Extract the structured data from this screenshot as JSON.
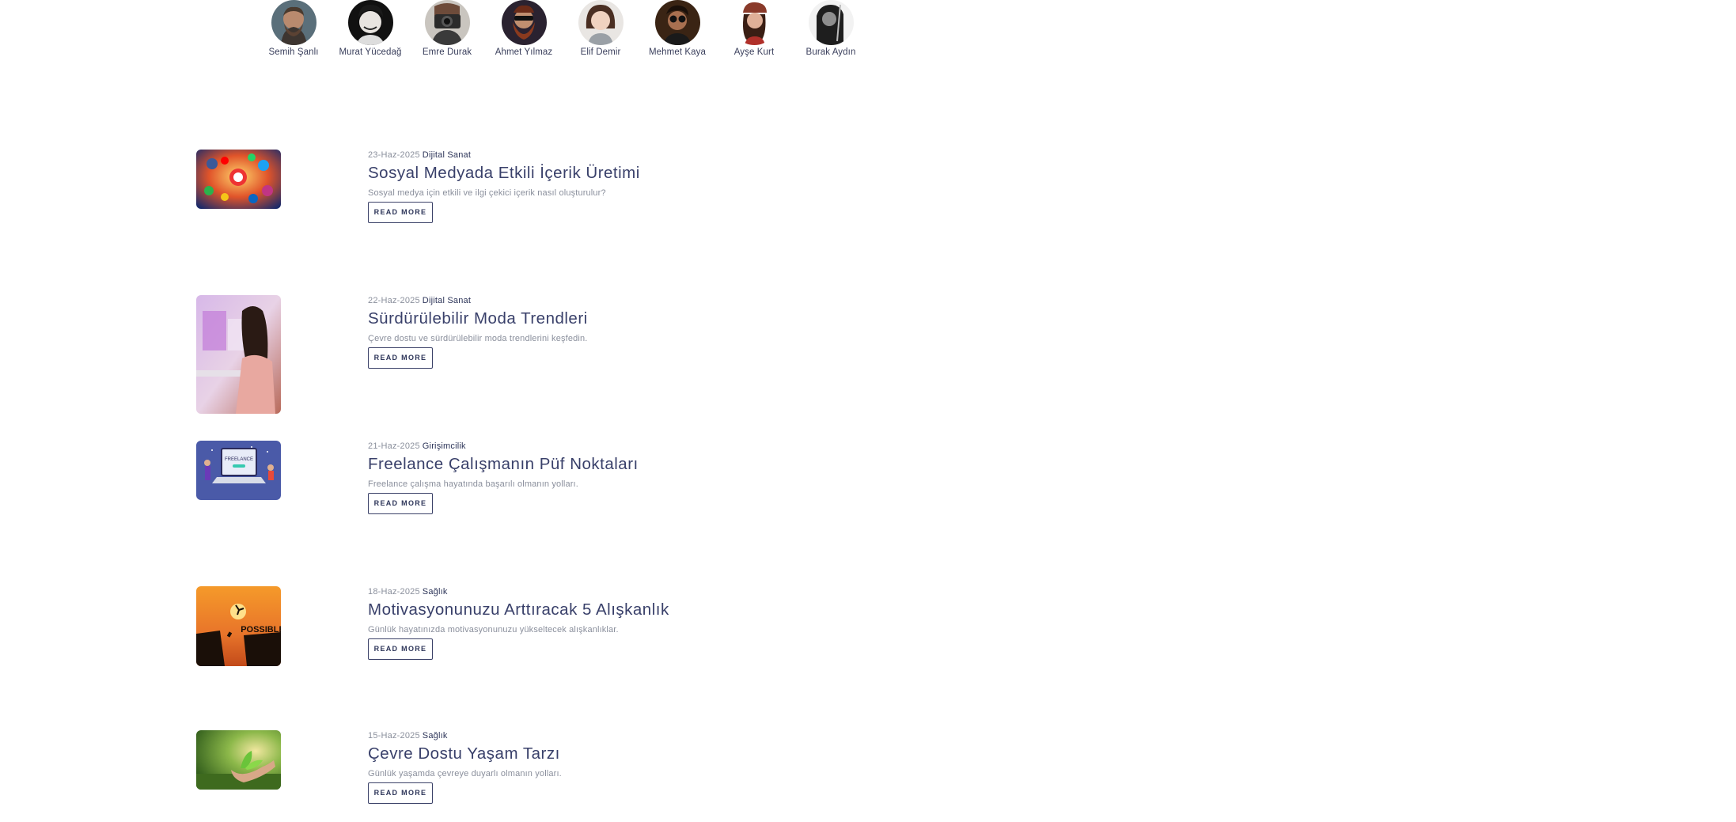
{
  "authors": [
    {
      "name": "Semih Şanlı",
      "icon": "avatar-semih"
    },
    {
      "name": "Murat Yücedağ",
      "icon": "avatar-murat"
    },
    {
      "name": "Emre Durak",
      "icon": "avatar-emre"
    },
    {
      "name": "Ahmet Yılmaz",
      "icon": "avatar-ahmet"
    },
    {
      "name": "Elif Demir",
      "icon": "avatar-elif"
    },
    {
      "name": "Mehmet Kaya",
      "icon": "avatar-mehmet"
    },
    {
      "name": "Ayşe Kurt",
      "icon": "avatar-ayse"
    },
    {
      "name": "Burak Aydın",
      "icon": "avatar-burak"
    }
  ],
  "posts": [
    {
      "date": "23-Haz-2025",
      "category": "Dijital Sanat",
      "title": "Sosyal Medyada Etkili İçerik Üretimi",
      "excerpt": "Sosyal medya için etkili ve ilgi çekici içerik nasıl oluşturulur?",
      "button": "READ MORE",
      "image": "social-media-icons-image"
    },
    {
      "date": "22-Haz-2025",
      "category": "Dijital Sanat",
      "title": "Sürdürülebilir Moda Trendleri",
      "excerpt": "Çevre dostu ve sürdürülebilir moda trendlerini keşfedin.",
      "button": "READ MORE",
      "image": "woman-digital-art-image"
    },
    {
      "date": "21-Haz-2025",
      "category": "Girişimcilik",
      "title": "Freelance Çalışmanın Püf Noktaları",
      "excerpt": "Freelance çalışma hayatında başarılı olmanın yolları.",
      "button": "READ MORE",
      "image": "freelance-laptop-image",
      "image_text": "FREELANCE"
    },
    {
      "date": "18-Haz-2025",
      "category": "Sağlık",
      "title": "Motivasyonunuzu Arttıracak 5 Alışkanlık",
      "excerpt": "Günlük hayatınızda motivasyonunuzu yükseltecek alışkanlıklar.",
      "button": "READ MORE",
      "image": "cliff-jump-sunset-image",
      "image_text": "POSSIBLE"
    },
    {
      "date": "15-Haz-2025",
      "category": "Sağlık",
      "title": "Çevre Dostu Yaşam Tarzı",
      "excerpt": "Günlük yaşamda çevreye duyarlı olmanın yolları.",
      "button": "READ MORE",
      "image": "hands-holding-plant-image"
    }
  ]
}
